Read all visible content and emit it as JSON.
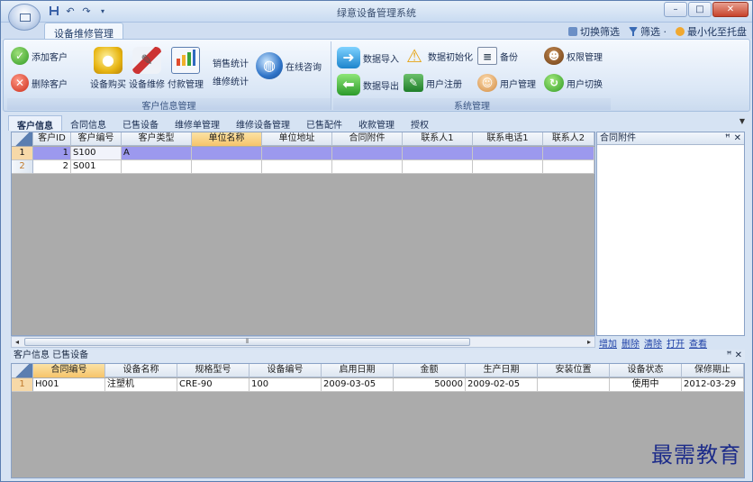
{
  "window": {
    "title": "绿意设备管理系统",
    "controls": {
      "minimize": "–",
      "maximize": "□",
      "close": "✕"
    }
  },
  "qat": {
    "icons": [
      "save-icon",
      "undo-icon",
      "redo-icon",
      "dropdown-icon"
    ]
  },
  "ribbon_tab": "设备维修管理",
  "right_commands": {
    "switch_filter": "切换筛选",
    "filter": "筛选 ·",
    "minimize_tray": "最小化至托盘"
  },
  "groups": {
    "customer": {
      "caption": "客户信息管理",
      "add_customer": "添加客户",
      "delete_customer": "删除客户",
      "equip_purchase": "设备购买",
      "equip_repair": "设备维修",
      "payment_mgmt": "付款管理",
      "sales_stats": "销售统计",
      "repair_stats": "维修统计",
      "online_consult": "在线咨询"
    },
    "system": {
      "caption": "系统管理",
      "data_import": "数据导入",
      "data_export": "数据导出",
      "data_init": "数据初始化",
      "user_register": "用户注册",
      "backup": "备份",
      "user_mgmt": "用户管理",
      "permission_mgmt": "权限管理",
      "user_switch": "用户切换"
    }
  },
  "doc_tabs": [
    "客户信息",
    "合同信息",
    "已售设备",
    "维修单管理",
    "维修设备管理",
    "已售配件",
    "收款管理",
    "授权"
  ],
  "customer_grid": {
    "columns": [
      "客户ID",
      "客户编号",
      "客户类型",
      "单位名称",
      "单位地址",
      "合同附件",
      "联系人1",
      "联系电话1",
      "联系人2"
    ],
    "rows": [
      {
        "num": "1",
        "id": "1",
        "code": "S100",
        "type": "A",
        "unit": "",
        "addr": "",
        "att": "",
        "c1": "",
        "p1": "",
        "c2": ""
      },
      {
        "num": "2",
        "id": "2",
        "code": "S001",
        "type": "",
        "unit": "",
        "addr": "",
        "att": "",
        "c1": "",
        "p1": "",
        "c2": ""
      }
    ]
  },
  "side_panel": {
    "title": "合同附件",
    "pin": "ꟸ",
    "close": "✕",
    "links": [
      "增加",
      "删除",
      "清除",
      "打开",
      "查看"
    ]
  },
  "scroll_arrows": {
    "left": "◂",
    "right": "▸",
    "grip": "⦀"
  },
  "bottom_pane": {
    "title": "客户信息 已售设备",
    "pin": "ꟸ ✕",
    "columns": [
      "合同编号",
      "设备名称",
      "规格型号",
      "设备编号",
      "启用日期",
      "金额",
      "生产日期",
      "安装位置",
      "设备状态",
      "保修期止"
    ],
    "rows": [
      {
        "num": "1",
        "contract": "H001",
        "name": "注塑机",
        "spec": "CRE-90",
        "equip_no": "100",
        "start": "2009-03-05",
        "amount": "50000",
        "prod": "2009-02-05",
        "loc": "",
        "status": "使用中",
        "warranty": "2012-03-29"
      }
    ]
  },
  "watermark": "最需教育",
  "colors": {
    "selected_row": "#9c99ee",
    "header_selected": "#f6c46a",
    "link": "#1c3fa6"
  }
}
